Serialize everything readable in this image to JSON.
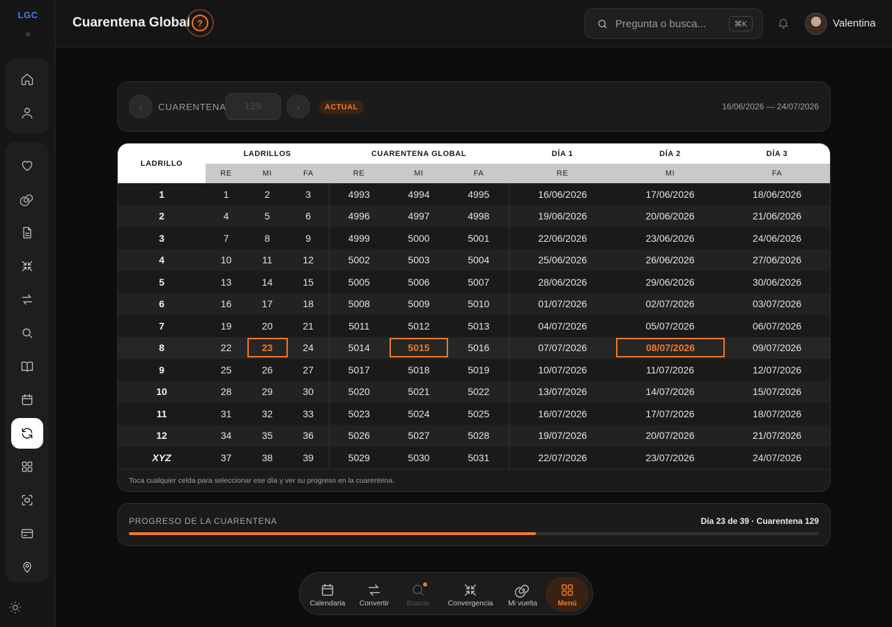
{
  "sidebar": {
    "logo": "LGC",
    "expand_icon": "double-chevron-right-icon",
    "group1": [
      "home-icon",
      "user-icon"
    ],
    "group2": [
      "heart-icon",
      "spiral-icon",
      "document-icon",
      "converge-icon",
      "swap-icon",
      "search-icon",
      "book-icon",
      "calendar-icon",
      "refresh-icon",
      "grid-icon",
      "scan-icon",
      "card-icon",
      "location-icon"
    ],
    "active": "refresh-icon",
    "theme_icon": "sun-icon"
  },
  "header": {
    "title": "Cuarentena Global",
    "help_glyph": "?",
    "search_placeholder": "Pregunta o busca...",
    "search_shortcut": "⌘K",
    "user_name": "Valentina"
  },
  "selector": {
    "prev_glyph": "‹",
    "next_glyph": "›",
    "label": "CUARENTENA",
    "value": "129",
    "badge": "ACTUAL",
    "date_range": "16/06/2026 — 24/07/2026"
  },
  "table": {
    "headers": {
      "ladrillo": "LADRILLO",
      "ladrillos": "LADRILLOS",
      "global": "CUARENTENA GLOBAL",
      "dia1": "DÍA 1",
      "dia2": "DÍA 2",
      "dia3": "DÍA 3"
    },
    "subheaders": [
      "RE",
      "MI",
      "FA",
      "RE",
      "MI",
      "FA",
      "RE",
      "MI",
      "FA"
    ],
    "rows": [
      [
        "1",
        "1",
        "2",
        "3",
        "4993",
        "4994",
        "4995",
        "16/06/2026",
        "17/06/2026",
        "18/06/2026"
      ],
      [
        "2",
        "4",
        "5",
        "6",
        "4996",
        "4997",
        "4998",
        "19/06/2026",
        "20/06/2026",
        "21/06/2026"
      ],
      [
        "3",
        "7",
        "8",
        "9",
        "4999",
        "5000",
        "5001",
        "22/06/2026",
        "23/06/2026",
        "24/06/2026"
      ],
      [
        "4",
        "10",
        "11",
        "12",
        "5002",
        "5003",
        "5004",
        "25/06/2026",
        "26/06/2026",
        "27/06/2026"
      ],
      [
        "5",
        "13",
        "14",
        "15",
        "5005",
        "5006",
        "5007",
        "28/06/2026",
        "29/06/2026",
        "30/06/2026"
      ],
      [
        "6",
        "16",
        "17",
        "18",
        "5008",
        "5009",
        "5010",
        "01/07/2026",
        "02/07/2026",
        "03/07/2026"
      ],
      [
        "7",
        "19",
        "20",
        "21",
        "5011",
        "5012",
        "5013",
        "04/07/2026",
        "05/07/2026",
        "06/07/2026"
      ],
      [
        "8",
        "22",
        "23",
        "24",
        "5014",
        "5015",
        "5016",
        "07/07/2026",
        "08/07/2026",
        "09/07/2026"
      ],
      [
        "9",
        "25",
        "26",
        "27",
        "5017",
        "5018",
        "5019",
        "10/07/2026",
        "11/07/2026",
        "12/07/2026"
      ],
      [
        "10",
        "28",
        "29",
        "30",
        "5020",
        "5021",
        "5022",
        "13/07/2026",
        "14/07/2026",
        "15/07/2026"
      ],
      [
        "11",
        "31",
        "32",
        "33",
        "5023",
        "5024",
        "5025",
        "16/07/2026",
        "17/07/2026",
        "18/07/2026"
      ],
      [
        "12",
        "34",
        "35",
        "36",
        "5026",
        "5027",
        "5028",
        "19/07/2026",
        "20/07/2026",
        "21/07/2026"
      ],
      [
        "XYZ",
        "37",
        "38",
        "39",
        "5029",
        "5030",
        "5031",
        "22/07/2026",
        "23/07/2026",
        "24/07/2026"
      ]
    ],
    "selected_row": 7,
    "highlighted_cols": [
      2,
      5,
      8
    ],
    "note": "Toca cualquier celda para seleccionar ese día y ver su progreso en la cuarentena."
  },
  "progress": {
    "label": "PROGRESO DE LA CUARENTENA",
    "status": "Día 23 de 39 · Cuarentena 129",
    "fraction": 0.59
  },
  "dock": {
    "items": [
      {
        "label": "Calendaria",
        "icon": "calendar-icon"
      },
      {
        "label": "Convertir",
        "icon": "swap-icon"
      },
      {
        "label": "Buscar",
        "icon": "search-icon"
      },
      {
        "label": "Convergencia",
        "icon": "converge-icon"
      },
      {
        "label": "Mi vuelta",
        "icon": "spiral-icon"
      },
      {
        "label": "Menú",
        "icon": "grid-icon"
      }
    ],
    "active": "Menú"
  },
  "colors": {
    "accent": "#f07a2a",
    "brand": "#4a7cf0",
    "background": "#0d0d0d"
  }
}
